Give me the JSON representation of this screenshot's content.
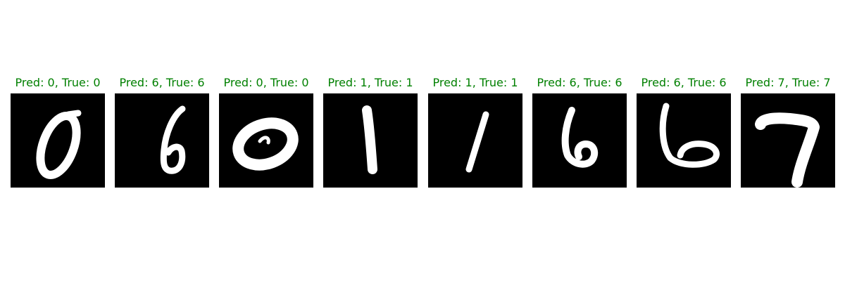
{
  "caption_color": "#008000",
  "panels": [
    {
      "predicted": "0",
      "true": "0",
      "caption": "Pred: 0, True: 0"
    },
    {
      "predicted": "6",
      "true": "6",
      "caption": "Pred: 6, True: 6"
    },
    {
      "predicted": "0",
      "true": "0",
      "caption": "Pred: 0, True: 0"
    },
    {
      "predicted": "1",
      "true": "1",
      "caption": "Pred: 1, True: 1"
    },
    {
      "predicted": "1",
      "true": "1",
      "caption": "Pred: 1, True: 1"
    },
    {
      "predicted": "6",
      "true": "6",
      "caption": "Pred: 6, True: 6"
    },
    {
      "predicted": "6",
      "true": "6",
      "caption": "Pred: 6, True: 6"
    },
    {
      "predicted": "7",
      "true": "7",
      "caption": "Pred: 7, True: 7"
    }
  ]
}
